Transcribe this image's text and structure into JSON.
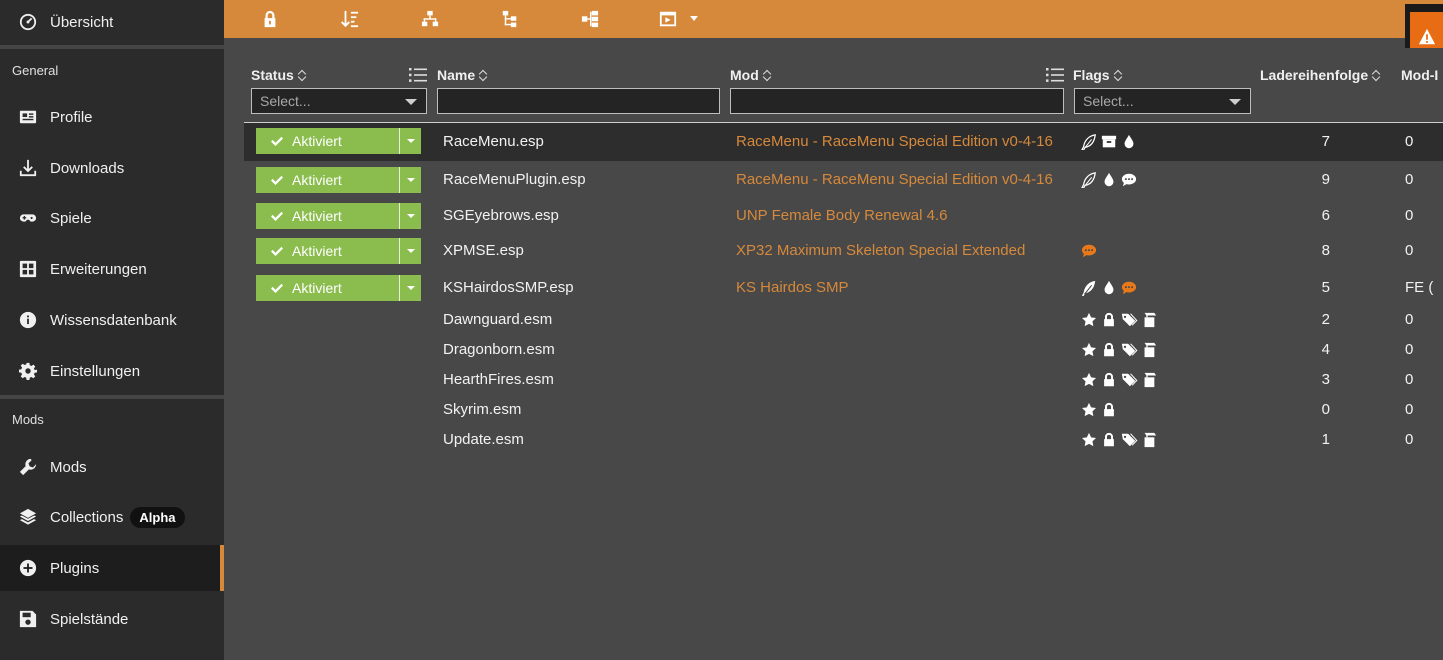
{
  "sidebar": {
    "overview": "Übersicht",
    "section_general": "General",
    "profile": "Profile",
    "downloads": "Downloads",
    "games": "Spiele",
    "extensions": "Erweiterungen",
    "knowledge": "Wissensdatenbank",
    "settings": "Einstellungen",
    "section_mods": "Mods",
    "mods": "Mods",
    "collections": "Collections",
    "collections_badge": "Alpha",
    "plugins": "Plugins",
    "saves": "Spielstände",
    "accent": "#d6893b"
  },
  "toolbar": {
    "icons": [
      "lock-icon",
      "sort-order-icon",
      "hierarchy-icon",
      "dependency-icon",
      "tree-icon",
      "panel-icon"
    ]
  },
  "table": {
    "headers": {
      "status": "Status",
      "name": "Name",
      "mod": "Mod",
      "flags": "Flags",
      "load_order": "Ladereihenfolge",
      "mod_index": "Mod-I"
    },
    "filters": {
      "status_placeholder": "Select...",
      "flags_placeholder": "Select...",
      "name_value": "",
      "mod_value": ""
    },
    "rows": [
      {
        "status": "Aktiviert",
        "name": "RaceMenu.esp",
        "mod": "RaceMenu - RaceMenu Special Edition v0-4-16",
        "flags": [
          "feather-outline",
          "archive",
          "drop"
        ],
        "order": "7",
        "modidx": "0"
      },
      {
        "status": "Aktiviert",
        "name": "RaceMenuPlugin.esp",
        "mod": "RaceMenu - RaceMenu Special Edition v0-4-16",
        "flags": [
          "feather-outline",
          "drop",
          "comment"
        ],
        "order": "9",
        "modidx": "0"
      },
      {
        "status": "Aktiviert",
        "name": "SGEyebrows.esp",
        "mod": "UNP Female Body Renewal 4.6",
        "flags": [],
        "order": "6",
        "modidx": "0"
      },
      {
        "status": "Aktiviert",
        "name": "XPMSE.esp",
        "mod": "XP32 Maximum Skeleton Special Extended",
        "flags": [
          "comment-orange"
        ],
        "order": "8",
        "modidx": "0"
      },
      {
        "status": "Aktiviert",
        "name": "KSHairdosSMP.esp",
        "mod": "KS Hairdos SMP",
        "flags": [
          "feather",
          "drop",
          "comment-orange"
        ],
        "order": "5",
        "modidx": "FE ("
      },
      {
        "status": "",
        "name": "Dawnguard.esm",
        "mod": "",
        "flags": [
          "star",
          "lock",
          "tags",
          "clean"
        ],
        "order": "2",
        "modidx": "0"
      },
      {
        "status": "",
        "name": "Dragonborn.esm",
        "mod": "",
        "flags": [
          "star",
          "lock",
          "tags",
          "clean"
        ],
        "order": "4",
        "modidx": "0"
      },
      {
        "status": "",
        "name": "HearthFires.esm",
        "mod": "",
        "flags": [
          "star",
          "lock",
          "tags",
          "clean"
        ],
        "order": "3",
        "modidx": "0"
      },
      {
        "status": "",
        "name": "Skyrim.esm",
        "mod": "",
        "flags": [
          "star",
          "lock"
        ],
        "order": "0",
        "modidx": "0"
      },
      {
        "status": "",
        "name": "Update.esm",
        "mod": "",
        "flags": [
          "star",
          "lock",
          "tags",
          "clean"
        ],
        "order": "1",
        "modidx": "0"
      }
    ]
  }
}
